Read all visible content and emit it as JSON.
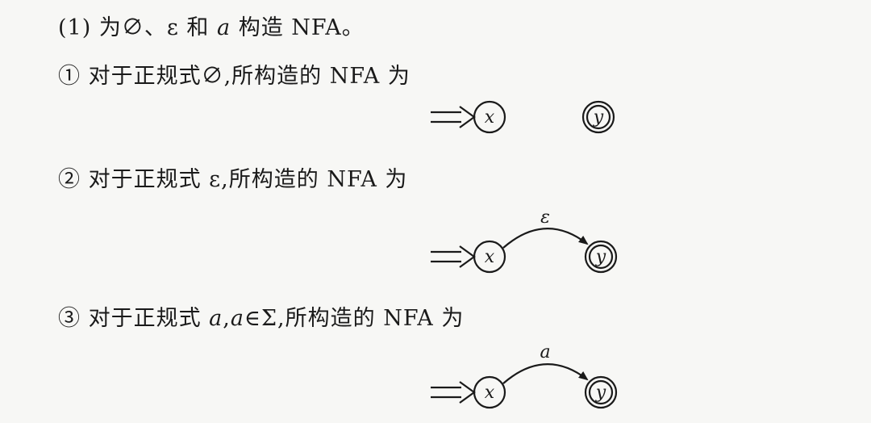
{
  "heading": {
    "num": "(1)",
    "t1": " 为",
    "empty": "∅",
    "t2": "、ε 和 ",
    "a": "a",
    "t3": " 构造 NFA。"
  },
  "items": [
    {
      "marker": "①",
      "text_before": " 对于正规式",
      "symbol": "∅",
      "text_after": ",所构造的 NFA 为",
      "nfa": {
        "start_state": "x",
        "final_state": "y",
        "edge_label": ""
      }
    },
    {
      "marker": "②",
      "text_before": " 对于正规式 ",
      "symbol": "ε",
      "text_after": ",所构造的 NFA 为",
      "nfa": {
        "start_state": "x",
        "final_state": "y",
        "edge_label": "ε"
      }
    },
    {
      "marker": "③",
      "text_before": " 对于正规式 ",
      "symbol": "a",
      "text_mid": ",",
      "symbol2": "a",
      "text_after": "∈Σ,所构造的 NFA 为",
      "nfa": {
        "start_state": "x",
        "final_state": "y",
        "edge_label": "a"
      }
    }
  ]
}
